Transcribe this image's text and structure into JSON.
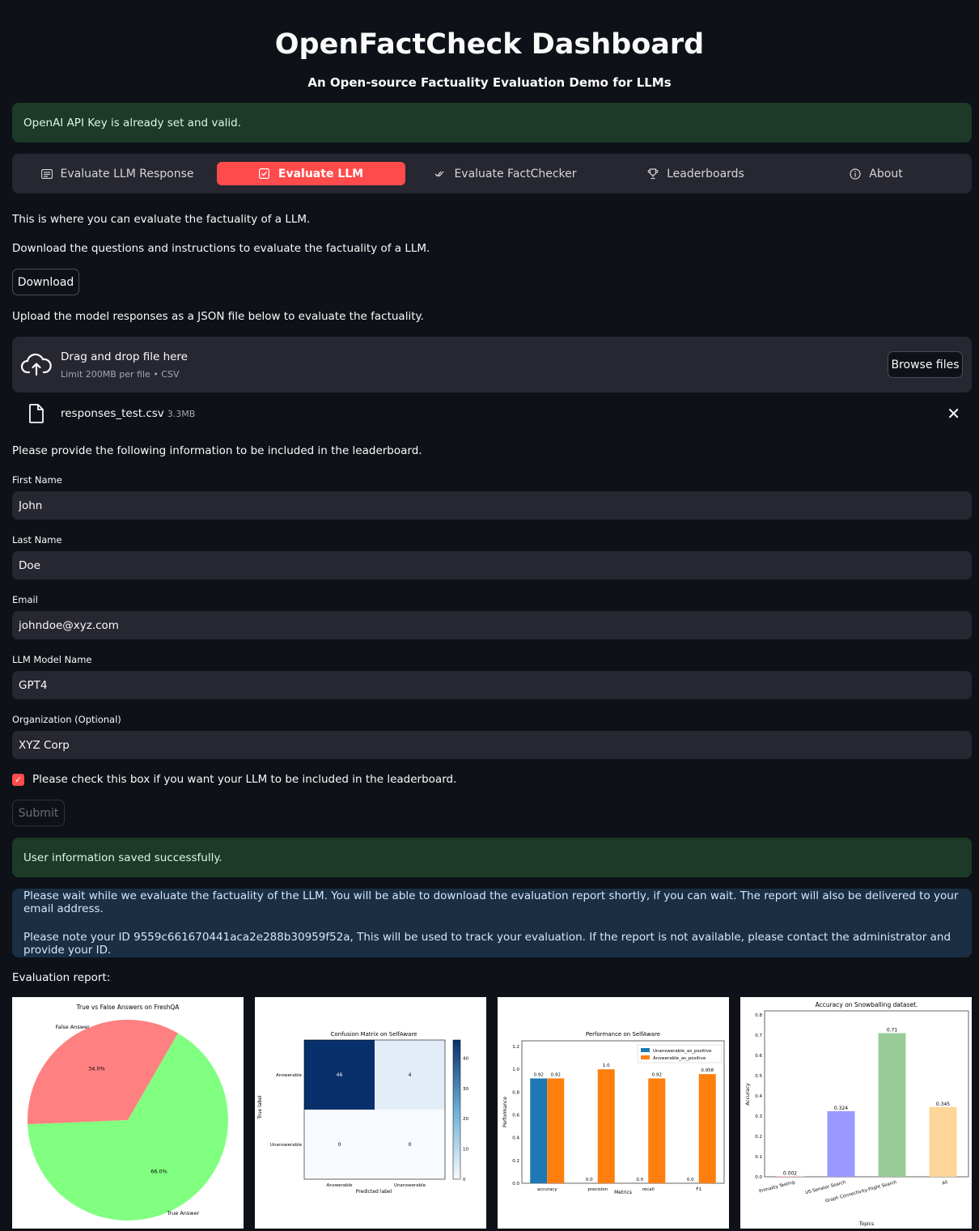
{
  "header": {
    "title": "OpenFactCheck Dashboard",
    "subtitle": "An Open-source Factuality Evaluation Demo for LLMs"
  },
  "api_alert": "OpenAI API Key is already set and valid.",
  "tabs": [
    {
      "label": "Evaluate LLM Response",
      "icon": "list-icon"
    },
    {
      "label": "Evaluate LLM",
      "icon": "checkbox-icon",
      "active": true
    },
    {
      "label": "Evaluate FactChecker",
      "icon": "double-check-icon"
    },
    {
      "label": "Leaderboards",
      "icon": "trophy-icon"
    },
    {
      "label": "About",
      "icon": "info-icon"
    }
  ],
  "intro": {
    "line1": "This is where you can evaluate the factuality of a LLM.",
    "line2": "Download the questions and instructions to evaluate the factuality of a LLM.",
    "download_label": "Download",
    "line3": "Upload the model responses as a JSON file below to evaluate the factuality."
  },
  "uploader": {
    "title": "Drag and drop file here",
    "subtitle": "Limit 200MB per file • CSV",
    "browse_label": "Browse files",
    "file_name": "responses_test.csv",
    "file_size": "3.3MB"
  },
  "form": {
    "intro": "Please provide the following information to be included in the leaderboard.",
    "fields": [
      {
        "label": "First Name",
        "value": "John"
      },
      {
        "label": "Last Name",
        "value": "Doe"
      },
      {
        "label": "Email",
        "value": "johndoe@xyz.com"
      },
      {
        "label": "LLM Model Name",
        "value": "GPT4"
      },
      {
        "label": "Organization (Optional)",
        "value": "XYZ Corp"
      }
    ],
    "checkbox_label": "Please check this box if you want your LLM to be included in the leaderboard.",
    "checkbox_checked": true,
    "submit_label": "Submit"
  },
  "success_alert": "User information saved successfully.",
  "info_alert": {
    "line1": "Please wait while we evaluate the factuality of the LLM. You will be able to download the evaluation report shortly, if you can wait. The report will also be delivered to your email address.",
    "line2": "Please note your ID 9559c661670441aca2e288b30959f52a, This will be used to track your evaluation. If the report is not available, please contact the administrator and provide your ID."
  },
  "report_label": "Evaluation report:",
  "colors": {
    "accent": "#ff4b4b",
    "pie_false": "#ff8080",
    "pie_true": "#80ff80",
    "bar_blue": "#1f77b4",
    "bar_orange": "#ff7f0e"
  },
  "chart_data": [
    {
      "type": "pie",
      "title": "True vs False Answers on FreshQA",
      "labels": [
        "False Answer",
        "True Answer"
      ],
      "values": [
        34.0,
        66.0
      ],
      "value_labels": [
        "34.0%",
        "66.0%"
      ]
    },
    {
      "type": "heatmap",
      "title": "Confusion Matrix on SelfAware",
      "xlabel": "Predicted label",
      "ylabel": "True label",
      "x_categories": [
        "Answerable",
        "Unanswerable"
      ],
      "y_categories": [
        "Answerable",
        "Unanswerable"
      ],
      "matrix": [
        [
          46,
          4
        ],
        [
          0,
          0
        ]
      ],
      "colorbar_ticks": [
        "40",
        "30",
        "20",
        "10",
        "0"
      ],
      "vmin": 0,
      "vmax": 46
    },
    {
      "type": "bar",
      "title": "Performance on SelfAware",
      "xlabel": "Metrics",
      "ylabel": "Performance",
      "categories": [
        "accuracy",
        "precision",
        "recall",
        "F1"
      ],
      "series": [
        {
          "name": "Unanswerable_as_positive",
          "values": [
            0.92,
            0.0,
            0.0,
            0.0
          ],
          "labels": [
            "0.92",
            "0.0",
            "0.0",
            "0.0"
          ]
        },
        {
          "name": "Answerable_as_positive",
          "values": [
            0.92,
            1.0,
            0.92,
            0.958
          ],
          "labels": [
            "0.92",
            "1.0",
            "0.92",
            "0.958"
          ]
        }
      ],
      "ylim": [
        0,
        1.25
      ],
      "yticks": [
        "0.0",
        "0.2",
        "0.4",
        "0.6",
        "0.8",
        "1.0",
        "1.2"
      ],
      "legend": "top-right"
    },
    {
      "type": "bar",
      "title": "Accuracy on Snowballing dataset.",
      "xlabel": "Topics",
      "ylabel": "Accuracy",
      "categories": [
        "Primality Testing",
        "US Senator Search",
        "Graph Connectivity-Flight Search",
        "All"
      ],
      "values": [
        0.002,
        0.324,
        0.71,
        0.345
      ],
      "value_labels": [
        "0.002",
        "0.324",
        "0.71",
        "0.345"
      ],
      "colors": [
        "#ff9999",
        "#9999ff",
        "#99cc99",
        "#ffd699"
      ],
      "ylim": [
        0,
        0.82
      ],
      "yticks": [
        "0.0",
        "0.1",
        "0.2",
        "0.3",
        "0.4",
        "0.5",
        "0.6",
        "0.7",
        "0.8"
      ]
    }
  ]
}
